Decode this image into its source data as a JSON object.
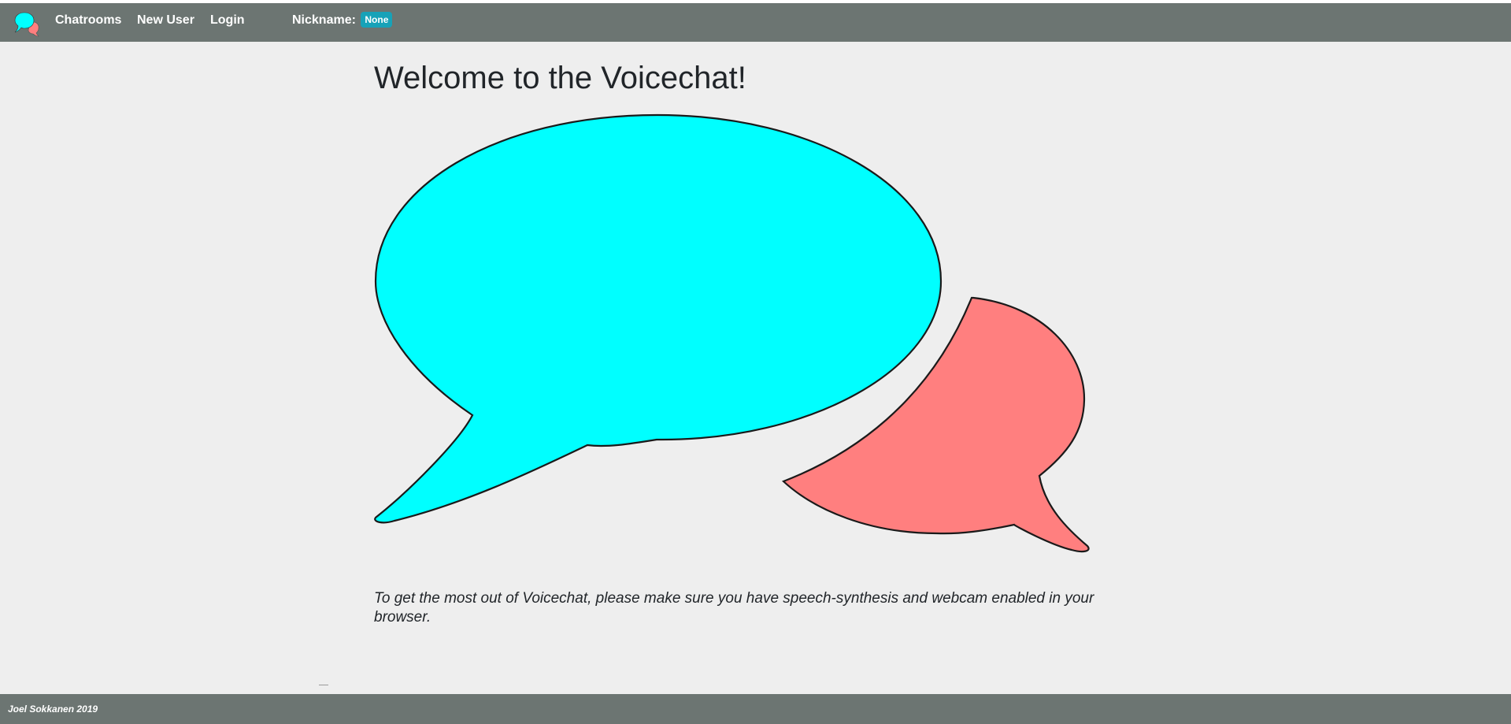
{
  "navbar": {
    "logo_icon": "speech-bubbles-logo-icon",
    "links": [
      "Chatrooms",
      "New User",
      "Login"
    ],
    "nickname_label": "Nickname:",
    "nickname_value": "None"
  },
  "main": {
    "title": "Welcome to the Voicechat!",
    "hero_icon": "speech-bubbles-illustration",
    "intro_text": "To get the most out of Voicechat, please make sure you have speech-synthesis and webcam enabled in your browser."
  },
  "footer": {
    "credit": "Joel Sokkanen 2019"
  },
  "colors": {
    "navbar_bg": "#6c7572",
    "page_bg": "#eeeeee",
    "badge_bg": "#17a2b8",
    "bubble_cyan": "#00ffff",
    "bubble_pink": "#ff7f7f"
  }
}
